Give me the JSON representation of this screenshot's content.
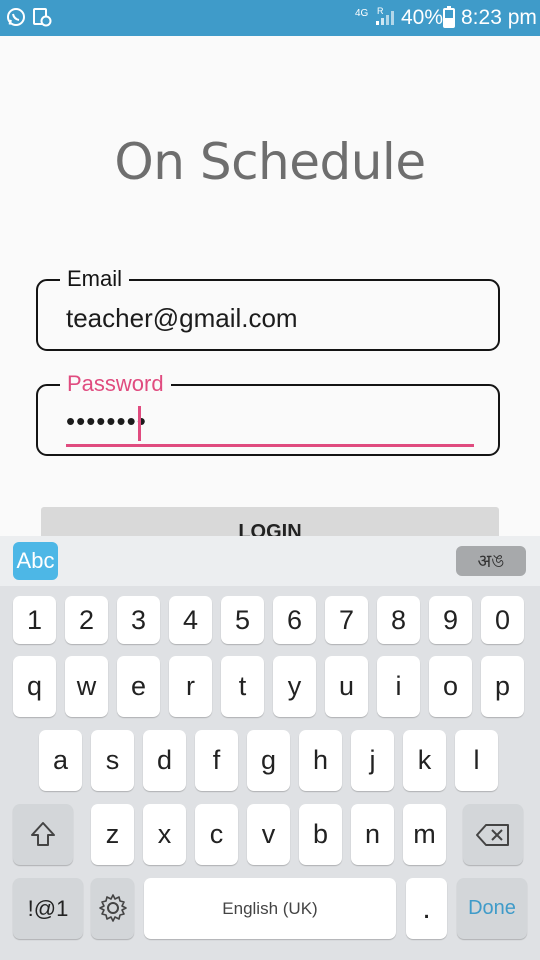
{
  "status_bar": {
    "network": "4G",
    "roaming": "R",
    "battery": "40%",
    "time": "8:23 pm",
    "icons": [
      "whatsapp-icon",
      "notification-icon",
      "signal-icon",
      "battery-icon"
    ],
    "color": "#3f9bc9"
  },
  "app": {
    "title": "On Schedule",
    "email": {
      "label": "Email",
      "value": "teacher@gmail.com"
    },
    "password": {
      "label": "Password",
      "value": "••••••••"
    },
    "login_label": "LOGIN",
    "accent_color": "#e04b7f"
  },
  "keyboard": {
    "mode_label": "Abc",
    "lang_switch_label": "अঙ",
    "row_numbers": [
      "1",
      "2",
      "3",
      "4",
      "5",
      "6",
      "7",
      "8",
      "9",
      "0"
    ],
    "row1": [
      "q",
      "w",
      "e",
      "r",
      "t",
      "y",
      "u",
      "i",
      "o",
      "p"
    ],
    "row2": [
      "a",
      "s",
      "d",
      "f",
      "g",
      "h",
      "j",
      "k",
      "l"
    ],
    "row3": [
      "z",
      "x",
      "c",
      "v",
      "b",
      "n",
      "m"
    ],
    "symbols_label": "!@1",
    "space_label": "English (UK)",
    "period_label": ".",
    "done_label": "Done"
  }
}
